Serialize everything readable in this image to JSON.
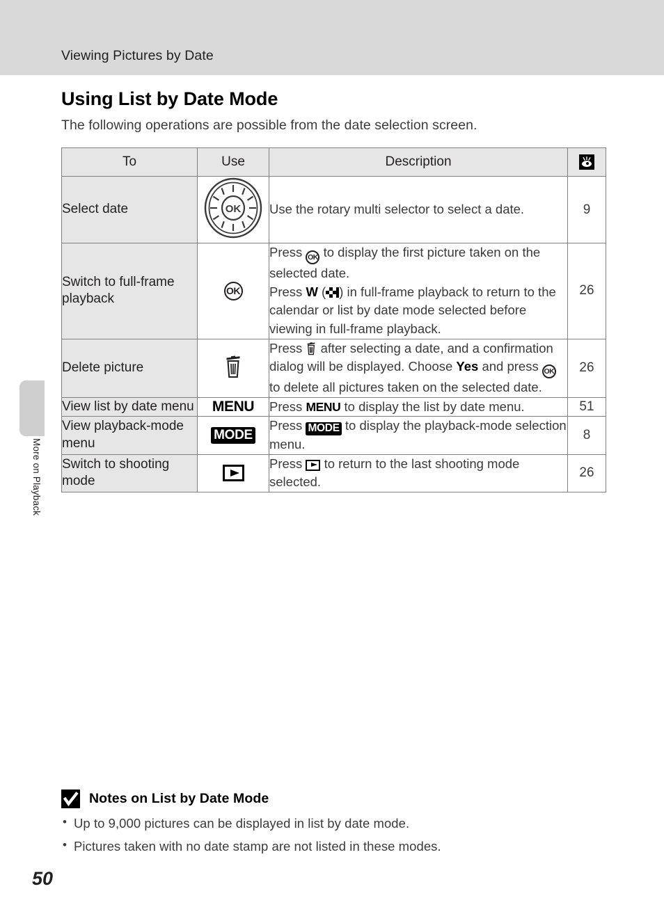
{
  "header": {
    "running_title": "Viewing Pictures by Date"
  },
  "side_tab": {
    "label": "More on Playback"
  },
  "section": {
    "title": "Using List by Date Mode",
    "intro": "The following operations are possible from the date selection screen."
  },
  "table": {
    "headers": {
      "to": "To",
      "use": "Use",
      "description": "Description",
      "reference": "reference-page-icon"
    },
    "rows": [
      {
        "to": "Select date",
        "use_icon": "rotary-multi-selector-dial-icon",
        "use_label": "OK",
        "description": "Use the rotary multi selector to select a date.",
        "reference": "9"
      },
      {
        "to": "Switch to full-frame playback",
        "use_icon": "ok-button-icon",
        "use_label": "OK",
        "description_parts": {
          "p1": "Press ",
          "p2": " to display the first picture taken on the selected date.",
          "p3": "Press ",
          "p4": "W",
          "p5": " (",
          "p6": ") in full-frame playback to return to the calendar or list by date mode selected before viewing in full-frame playback."
        },
        "reference": "26"
      },
      {
        "to": "Delete picture",
        "use_icon": "trash-delete-icon",
        "description_parts": {
          "p1": "Press ",
          "p2": " after selecting a date, and a confirmation dialog will be displayed. Choose ",
          "p3": "Yes",
          "p4": " and press ",
          "p5": " to delete all pictures taken on the selected date."
        },
        "reference": "26"
      },
      {
        "to": "View list by date menu",
        "use_icon": "menu-button-icon",
        "use_label": "MENU",
        "description_parts": {
          "p1": "Press ",
          "p2": "MENU",
          "p3": " to display the list by date menu."
        },
        "reference": "51"
      },
      {
        "to": "View playback-mode menu",
        "use_icon": "mode-button-icon",
        "use_label": "MODE",
        "description_parts": {
          "p1": "Press ",
          "p2": "MODE",
          "p3": " to display the playback-mode selection menu."
        },
        "reference": "8"
      },
      {
        "to": "Switch to shooting mode",
        "use_icon": "playback-button-icon",
        "description_parts": {
          "p1": "Press ",
          "p2": " to return to the last shooting mode selected."
        },
        "reference": "26"
      }
    ]
  },
  "notes": {
    "icon": "caution-check-icon",
    "title": "Notes on List by Date Mode",
    "items": [
      "Up to 9,000 pictures can be displayed in list by date mode.",
      "Pictures taken with no date stamp are not listed in these modes."
    ]
  },
  "footer": {
    "page_number": "50"
  },
  "colors": {
    "header_bar": "#d9d9d9",
    "table_header_fill": "#e6e6e6",
    "table_border": "#808080",
    "text": "#231f20",
    "body_text": "#3b3b3b"
  }
}
